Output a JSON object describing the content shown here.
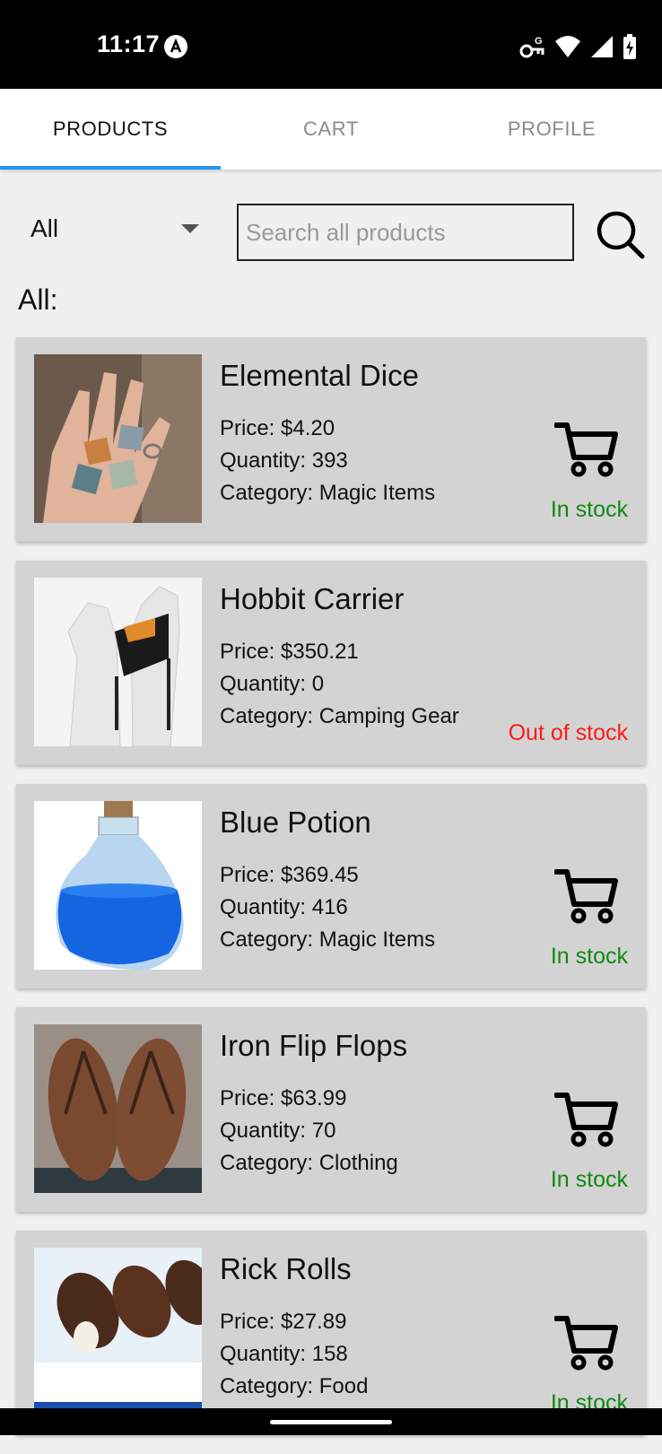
{
  "status": {
    "time": "11:17",
    "icons": [
      "assistant-icon",
      "key-icon",
      "wifi-icon",
      "signal-icon",
      "battery-charging-icon"
    ]
  },
  "tabs": [
    {
      "label": "PRODUCTS",
      "active": true
    },
    {
      "label": "CART",
      "active": false
    },
    {
      "label": "PROFILE",
      "active": false
    }
  ],
  "filter": {
    "category": "All",
    "search_placeholder": "Search all products",
    "search_value": ""
  },
  "section_title": "All:",
  "products": [
    {
      "name": "Elemental Dice",
      "price": "Price: $4.20",
      "quantity": "Quantity: 393",
      "category": "Category: Magic Items",
      "stock": "In stock",
      "in_stock": true
    },
    {
      "name": "Hobbit Carrier",
      "price": "Price: $350.21",
      "quantity": "Quantity: 0",
      "category": "Category: Camping Gear",
      "stock": "Out of stock",
      "in_stock": false
    },
    {
      "name": "Blue Potion",
      "price": "Price: $369.45",
      "quantity": "Quantity: 416",
      "category": "Category: Magic Items",
      "stock": "In stock",
      "in_stock": true
    },
    {
      "name": "Iron Flip Flops",
      "price": "Price: $63.99",
      "quantity": "Quantity: 70",
      "category": "Category: Clothing",
      "stock": "In stock",
      "in_stock": true
    },
    {
      "name": "Rick Rolls",
      "price": "Price: $27.89",
      "quantity": "Quantity: 158",
      "category": "Category: Food",
      "stock": "In stock",
      "in_stock": true
    }
  ],
  "colors": {
    "accent": "#2196f3",
    "in_stock": "#118811",
    "out_of_stock": "#ff1a1a",
    "card_bg": "#d3d3d3"
  }
}
